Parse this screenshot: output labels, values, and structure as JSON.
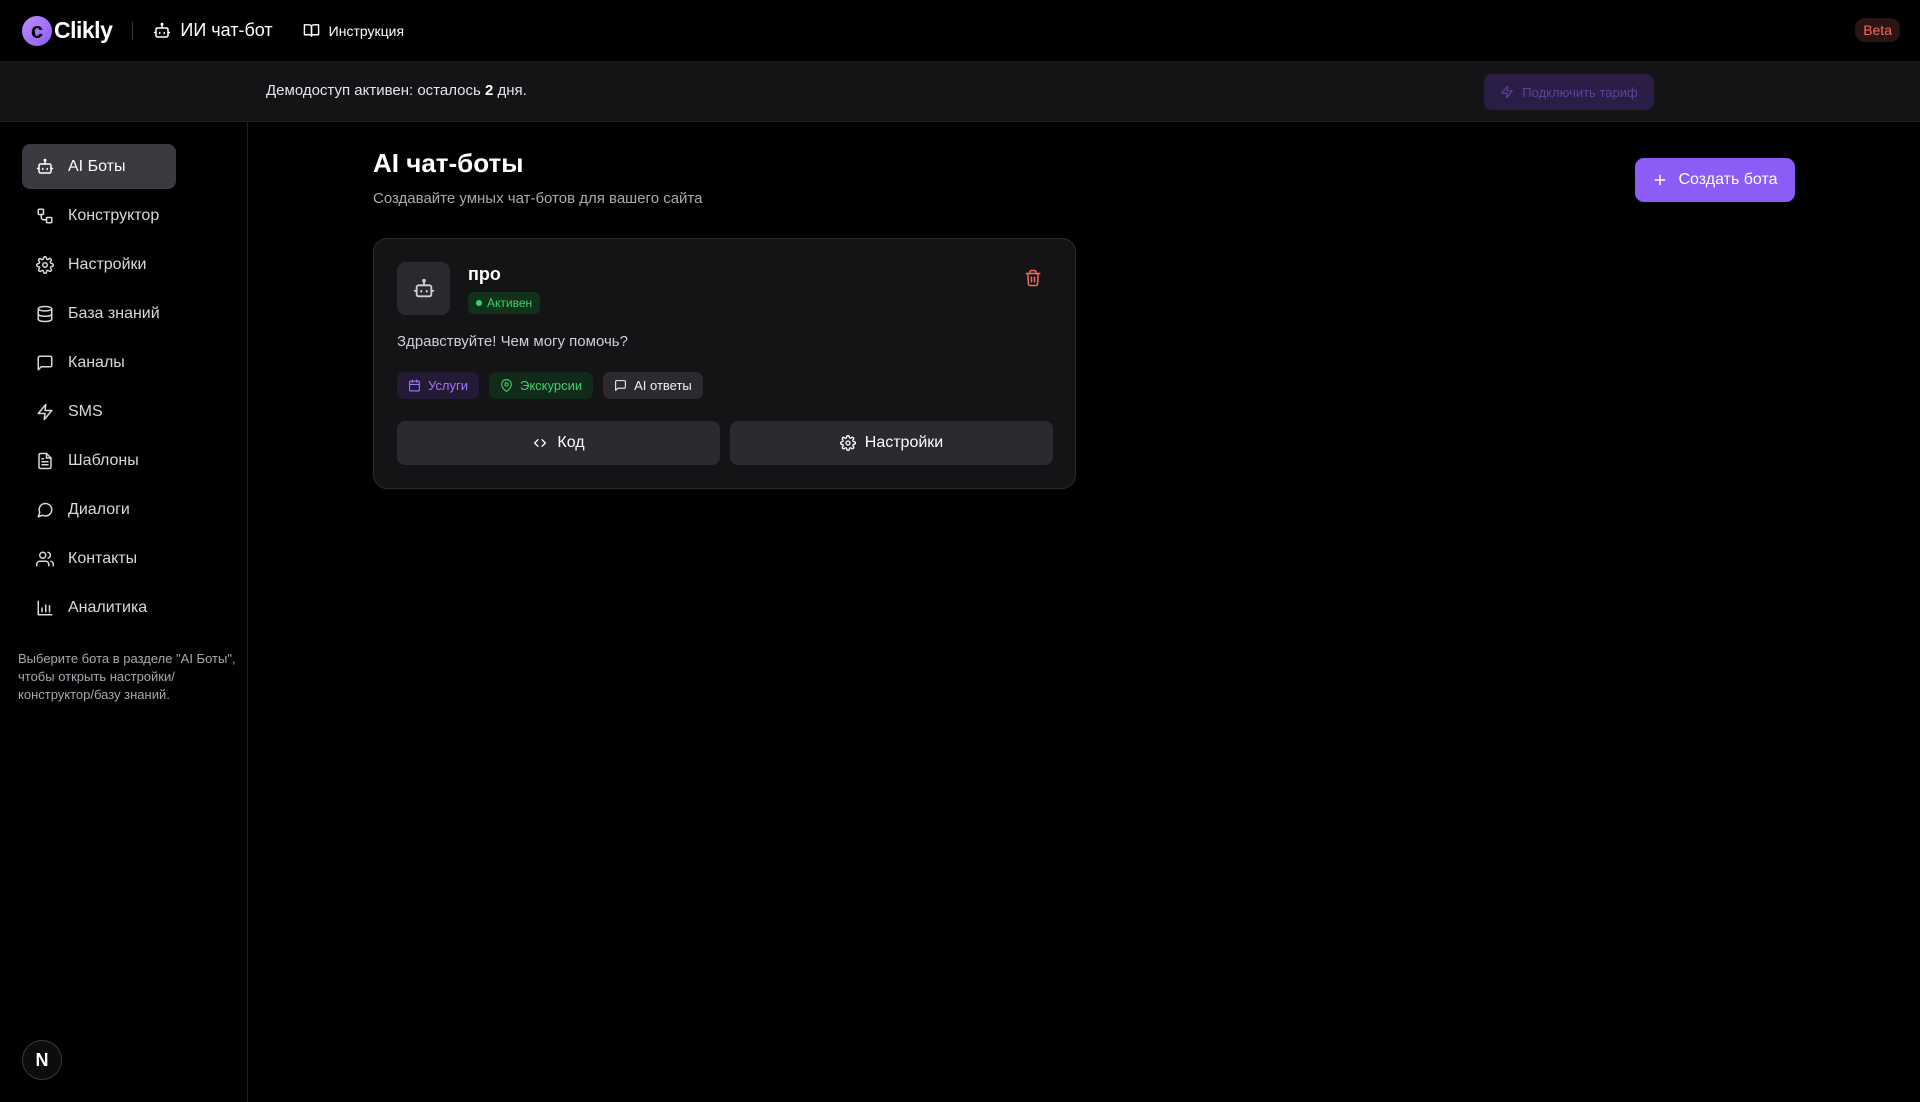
{
  "header": {
    "logo_letter": "c",
    "logo_text": "Clikly",
    "section_title": "ИИ чат-бот",
    "instructions_label": "Инструкция",
    "beta_label": "Beta"
  },
  "demo": {
    "text_before": "Демодоступ активен: осталось ",
    "days": "2",
    "text_after": " дня.",
    "tariff_button": "Подключить тариф"
  },
  "sidebar": {
    "items": [
      {
        "label": "AI Боты",
        "icon": "bot-icon",
        "active": true
      },
      {
        "label": "Конструктор",
        "icon": "workflow-icon"
      },
      {
        "label": "Настройки",
        "icon": "gear-icon"
      },
      {
        "label": "База знаний",
        "icon": "database-icon"
      },
      {
        "label": "Каналы",
        "icon": "message-square-icon"
      },
      {
        "label": "SMS",
        "icon": "bolt-icon"
      },
      {
        "label": "Шаблоны",
        "icon": "file-text-icon"
      },
      {
        "label": "Диалоги",
        "icon": "chat-bubble-icon"
      },
      {
        "label": "Контакты",
        "icon": "users-icon"
      },
      {
        "label": "Аналитика",
        "icon": "bar-chart-icon"
      }
    ],
    "hint": "Выберите бота в разделе \"AI Боты\", чтобы открыть настройки/конструктор/базу знаний.",
    "avatar_letter": "N"
  },
  "main": {
    "title": "AI чат-боты",
    "subtitle": "Создавайте умных чат-ботов для вашего сайта",
    "create_button": "Создать бота",
    "bot": {
      "name": "про",
      "status": "Активен",
      "greeting": "Здравствуйте! Чем могу помочь?",
      "tags": [
        {
          "label": "Услуги",
          "icon": "calendar-icon"
        },
        {
          "label": "Экскурсии",
          "icon": "map-pin-icon"
        },
        {
          "label": "AI ответы",
          "icon": "message-square-icon"
        }
      ],
      "code_button": "Код",
      "settings_button": "Настройки"
    }
  },
  "colors": {
    "accent": "#8b5cf6",
    "active_green": "#35d46a",
    "danger": "#f26b5b",
    "background": "#000000"
  }
}
